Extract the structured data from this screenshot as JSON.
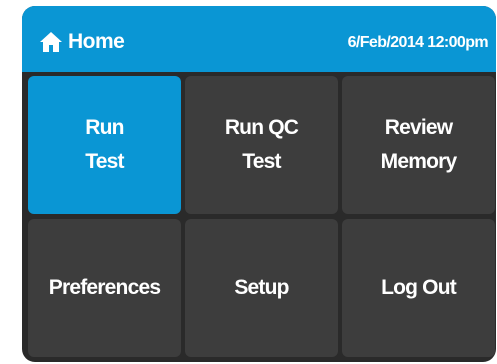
{
  "header": {
    "title": "Home",
    "icon": "home-icon",
    "datetime": "6/Feb/2014 12:00pm",
    "background_color": "#0a96d4"
  },
  "menu": {
    "buttons": [
      {
        "label": "Run\nTest",
        "active": true
      },
      {
        "label": "Run QC\nTest",
        "active": false
      },
      {
        "label": "Review\nMemory",
        "active": false
      },
      {
        "label": "Preferences",
        "active": false
      },
      {
        "label": "Setup",
        "active": false
      },
      {
        "label": "Log Out",
        "active": false
      }
    ],
    "active_color": "#0a96d4",
    "tile_color": "#3d3d3d"
  }
}
